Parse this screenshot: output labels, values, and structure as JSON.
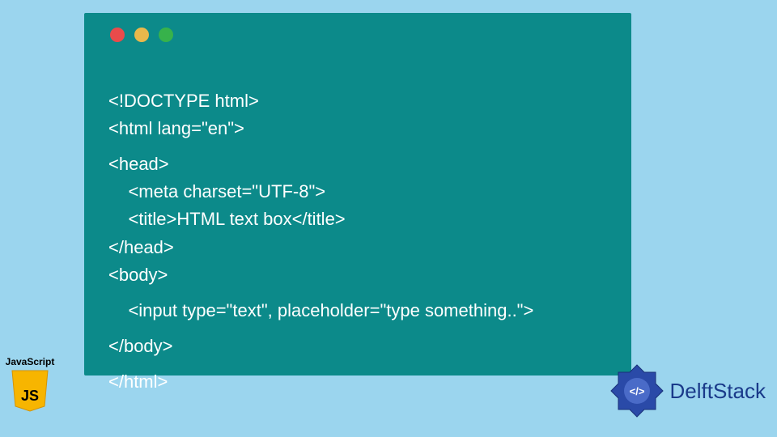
{
  "code_lines": {
    "l1": "<!DOCTYPE html>",
    "l2": "<html lang=\"en\">",
    "l3": "<head>",
    "l4": "    <meta charset=\"UTF-8\">",
    "l5": "    <title>HTML text box</title>",
    "l6": "</head>",
    "l7": "<body>",
    "l8": "    <input type=\"text\", placeholder=\"type something..\">",
    "l9": "</body>",
    "l10": "</html>"
  },
  "js_badge": {
    "label": "JavaScript",
    "short": "JS"
  },
  "brand": {
    "name": "DelftStack",
    "icon_glyph": "</>"
  },
  "colors": {
    "page_bg": "#9bd5ee",
    "code_bg": "#0c8a8a",
    "code_text": "#ffffff",
    "dot_red": "#e94b4b",
    "dot_yellow": "#e9b84b",
    "dot_green": "#37b24b",
    "js_yellow": "#f7b500",
    "brand_blue": "#1a3a8a"
  }
}
